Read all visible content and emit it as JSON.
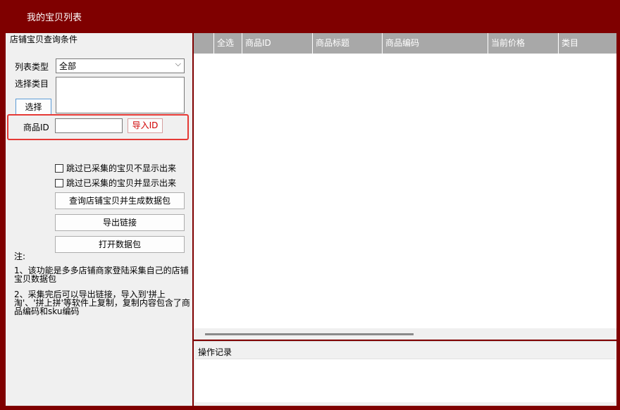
{
  "window": {
    "title": "我的宝贝列表"
  },
  "query": {
    "group_title": "店铺宝贝查询条件",
    "list_type_label": "列表类型",
    "list_type_value": "全部",
    "category_label": "选择类目",
    "select_button": "选择",
    "product_id_label": "商品ID",
    "product_id_value": "",
    "import_id_button": "导入ID",
    "skip_hide_label": "跳过已采集的宝贝不显示出来",
    "skip_show_label": "跳过已采集的宝贝并显示出来",
    "query_button": "查询店铺宝贝并生成数据包",
    "export_button": "导出链接",
    "open_button": "打开数据包"
  },
  "notes": {
    "heading": "注:",
    "line1": "1、该功能是多多店铺商家登陆采集自己的店铺宝贝数据包",
    "line2": "2、采集完后可以导出链接，导入到'拼上淘'、'拼上拼'等软件上复制，复制内容包含了商品编码和sku编码"
  },
  "table": {
    "columns": [
      "全选",
      "商品ID",
      "商品标题",
      "商品编码",
      "当前价格",
      "类目"
    ]
  },
  "log": {
    "title": "操作记录"
  }
}
